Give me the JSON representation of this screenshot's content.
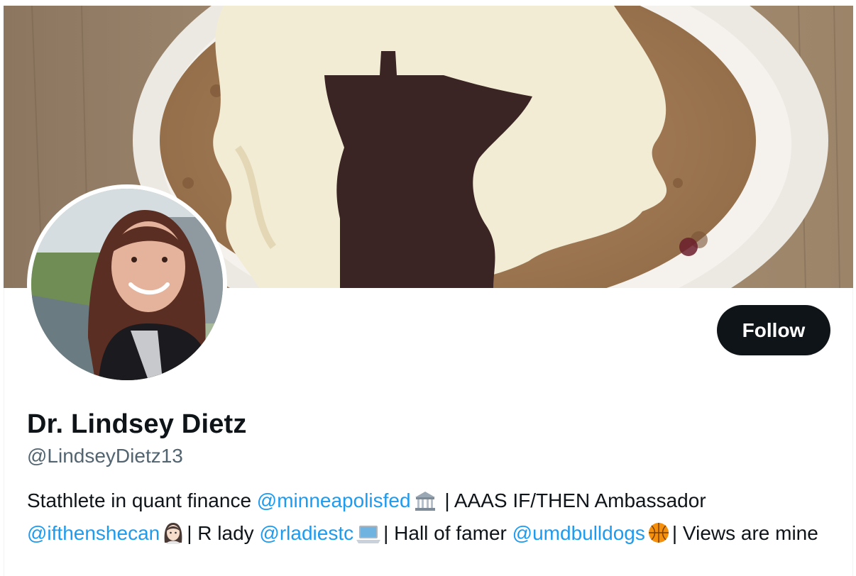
{
  "profile": {
    "display_name": "Dr. Lindsey Dietz",
    "handle": "@LindseyDietz13",
    "follow_label": "Follow"
  },
  "bio": {
    "t1": "Stathlete in quant finance ",
    "m1": "@minneapolisfed",
    "t2": " | AAAS IF/THEN Ambassador ",
    "m2": "@ifthenshecan",
    "t3": "| R lady ",
    "m3": "@rladiestc",
    "t4": "| Hall of famer ",
    "m4": "@umdbulldogs",
    "t5": "| Views are mine"
  },
  "icons": {
    "bank": "classical-building-emoji",
    "woman": "woman-emoji",
    "laptop": "laptop-emoji",
    "ball": "basketball-emoji"
  },
  "colors": {
    "text": "#0f1419",
    "secondary": "#536471",
    "link": "#1d9bf0",
    "button": "#0f1419"
  }
}
